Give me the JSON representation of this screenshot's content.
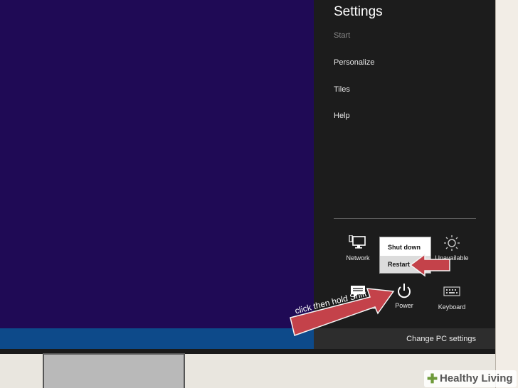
{
  "charm": {
    "title": "Settings",
    "start_label": "Start",
    "items": [
      "Personalize",
      "Tiles",
      "Help"
    ],
    "tiles": {
      "network": "Network",
      "unavailable": "Unavailable",
      "notifications": "Notifications",
      "power": "Power",
      "keyboard": "Keyboard"
    },
    "change_pc_settings": "Change PC settings"
  },
  "power_menu": {
    "shut_down": "Shut down",
    "restart": "Restart"
  },
  "annotation": {
    "callout": "click then hold Shift"
  },
  "watermark": {
    "text": "Healthy Living"
  },
  "colors": {
    "desktop": "#1f0a55",
    "taskbar": "#0d4a8a",
    "charm_bg": "#1c1c1c",
    "arrow_red": "#c4424a"
  }
}
